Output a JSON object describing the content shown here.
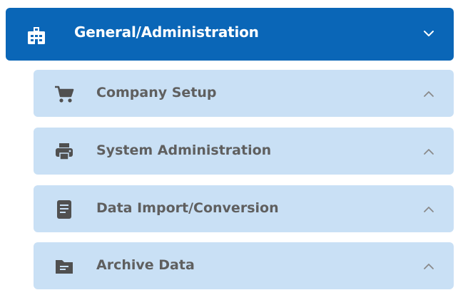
{
  "header": {
    "label": "General/Administration",
    "icon": "building-icon",
    "chevron": "chevron-down-icon",
    "background": "#0a66b7",
    "text_color": "#ffffff"
  },
  "items": [
    {
      "label": "Company Setup",
      "icon": "shopping-cart-icon",
      "chevron": "chevron-up-icon"
    },
    {
      "label": "System Administration",
      "icon": "printer-icon",
      "chevron": "chevron-up-icon"
    },
    {
      "label": "Data Import/Conversion",
      "icon": "document-icon",
      "chevron": "chevron-up-icon"
    },
    {
      "label": "Archive Data",
      "icon": "folder-icon",
      "chevron": "chevron-up-icon"
    }
  ],
  "colors": {
    "item_background": "#c9e0f5",
    "item_text": "#5f5f5f",
    "icon_color": "#505050"
  }
}
